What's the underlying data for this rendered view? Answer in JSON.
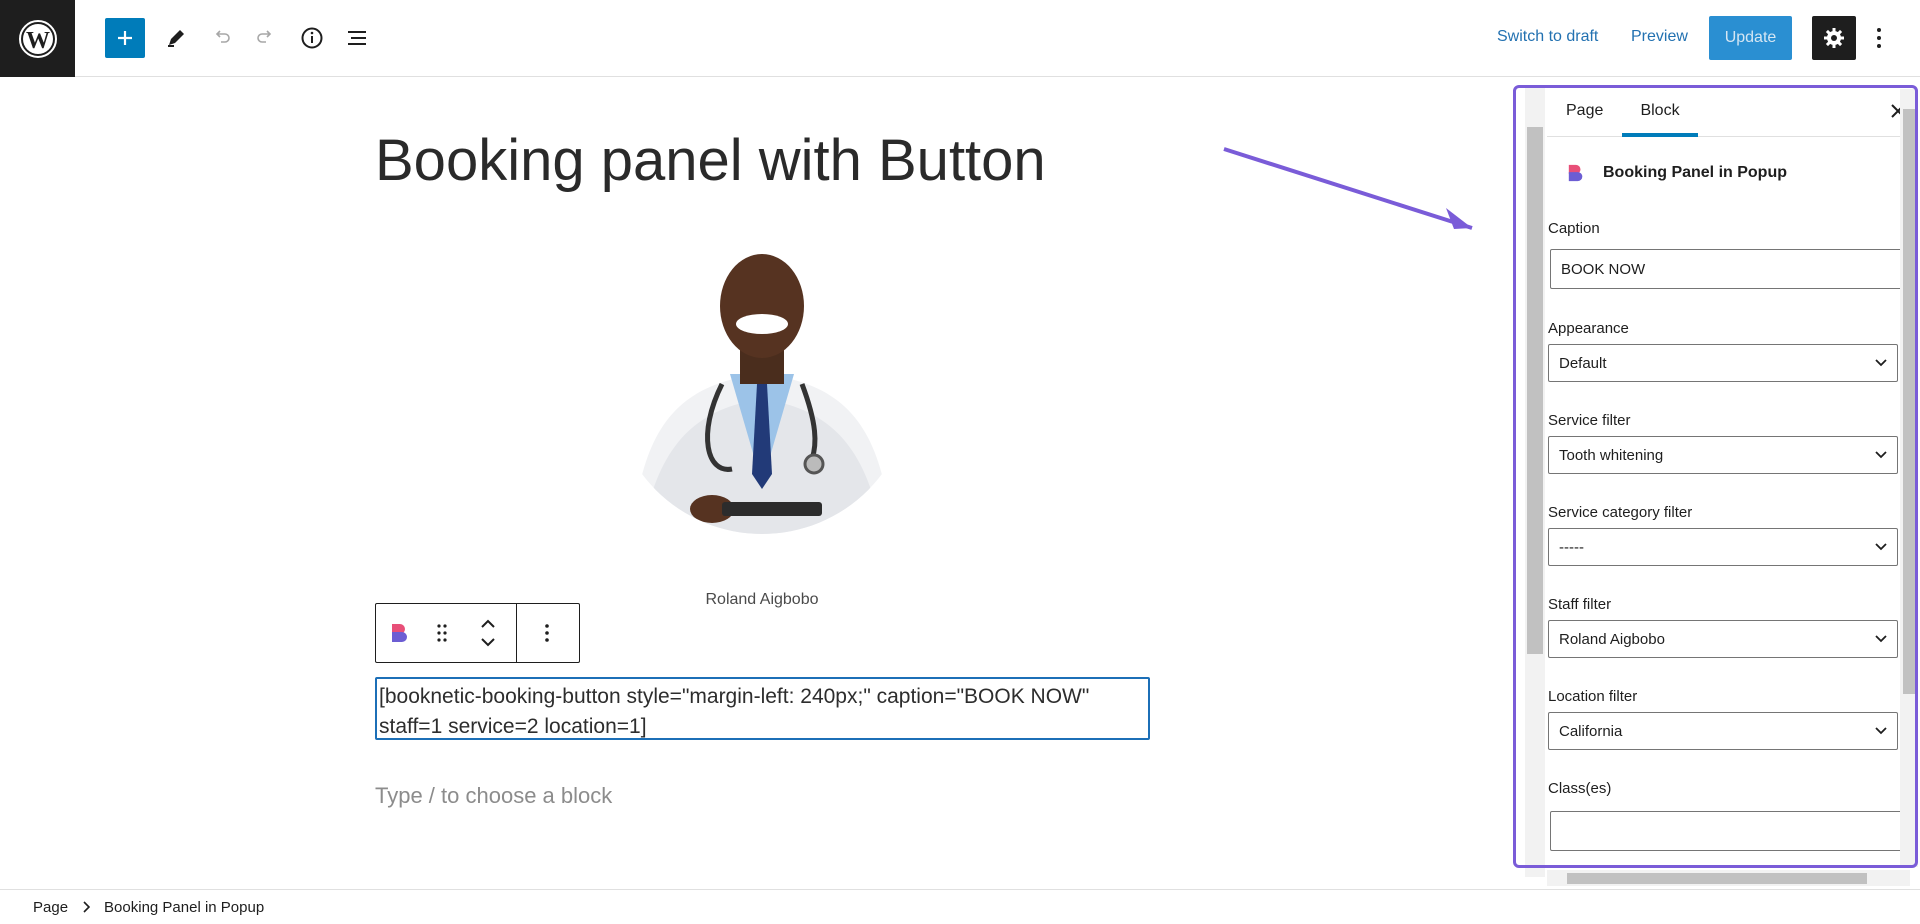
{
  "header": {
    "switch_to_draft": "Switch to draft",
    "preview": "Preview",
    "update": "Update"
  },
  "editor": {
    "title": "Booking panel with Button",
    "image_caption": "Roland Aigbobo",
    "shortcode": "[booknetic-booking-button style=\"margin-left: 240px;\" caption=\"BOOK NOW\" staff=1 service=2 location=1]",
    "placeholder": "Type / to choose a block"
  },
  "sidebar": {
    "tabs": [
      "Page",
      "Block"
    ],
    "active_tab": "Block",
    "block_name": "Booking Panel in Popup",
    "fields": {
      "caption_label": "Caption",
      "caption_value": "BOOK NOW",
      "appearance_label": "Appearance",
      "appearance_value": "Default",
      "service_label": "Service filter",
      "service_value": "Tooth whitening",
      "service_category_label": "Service category filter",
      "service_category_value": "-----",
      "staff_label": "Staff filter",
      "staff_value": "Roland Aigbobo",
      "location_label": "Location filter",
      "location_value": "California",
      "classes_label": "Class(es)",
      "classes_value": ""
    }
  },
  "footer": {
    "breadcrumb": [
      "Page",
      "Booking Panel in Popup"
    ]
  },
  "colors": {
    "accent": "#007cba",
    "highlight": "#7a5cd8"
  }
}
